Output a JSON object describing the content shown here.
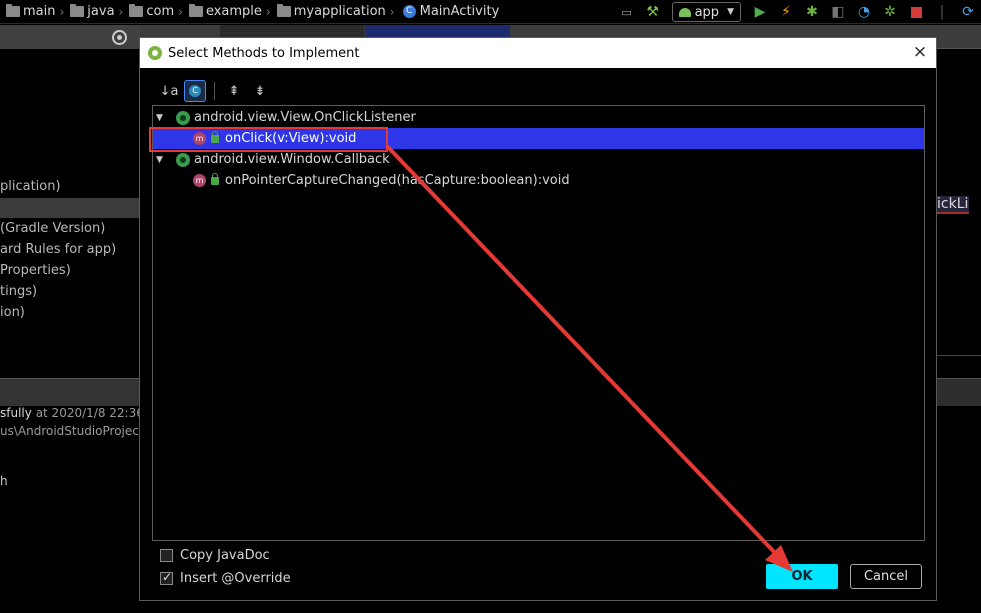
{
  "breadcrumb": {
    "items": [
      "main",
      "java",
      "com",
      "example",
      "myapplication"
    ],
    "class_icon": "C",
    "class_name": "MainActivity"
  },
  "toolbar": {
    "run_config": "app"
  },
  "project_tree": {
    "lines": [
      "plication)",
      "(Gradle Version)",
      "ard Rules for app)",
      "Properties)",
      "tings)",
      "ion)"
    ]
  },
  "editor": {
    "code_fragment": "ickLi"
  },
  "build_log": {
    "line1_status": "sfully",
    "line1_time": "at 2020/1/8 22:36",
    "line2": "us\\AndroidStudioProject",
    "line3": "h"
  },
  "dialog": {
    "title": "Select Methods to Implement",
    "close": "×",
    "toolbar": {
      "sort_icon_text": "↓a",
      "show_classes_icon_text": "C",
      "expand_all_icon_text": "⇞",
      "collapse_all_icon_text": "⇟"
    },
    "tree": [
      {
        "kind": "interface",
        "label": "android.view.View.OnClickListener"
      },
      {
        "kind": "method",
        "icon_text": "m",
        "label": "onClick(v:View):void",
        "selected": true
      },
      {
        "kind": "interface",
        "label": "android.view.Window.Callback"
      },
      {
        "kind": "method",
        "icon_text": "m",
        "label": "onPointerCaptureChanged(hasCapture:boolean):void",
        "selected": false
      }
    ],
    "options": {
      "copy_javadoc": {
        "label": "Copy JavaDoc",
        "checked": false
      },
      "insert_override": {
        "label": "Insert @Override",
        "checked": true
      }
    },
    "buttons": {
      "ok": "OK",
      "cancel": "Cancel"
    }
  },
  "colors": {
    "selection": "#2f36e8",
    "ok_button": "#00e5ff",
    "annotation_red": "#e53935"
  }
}
